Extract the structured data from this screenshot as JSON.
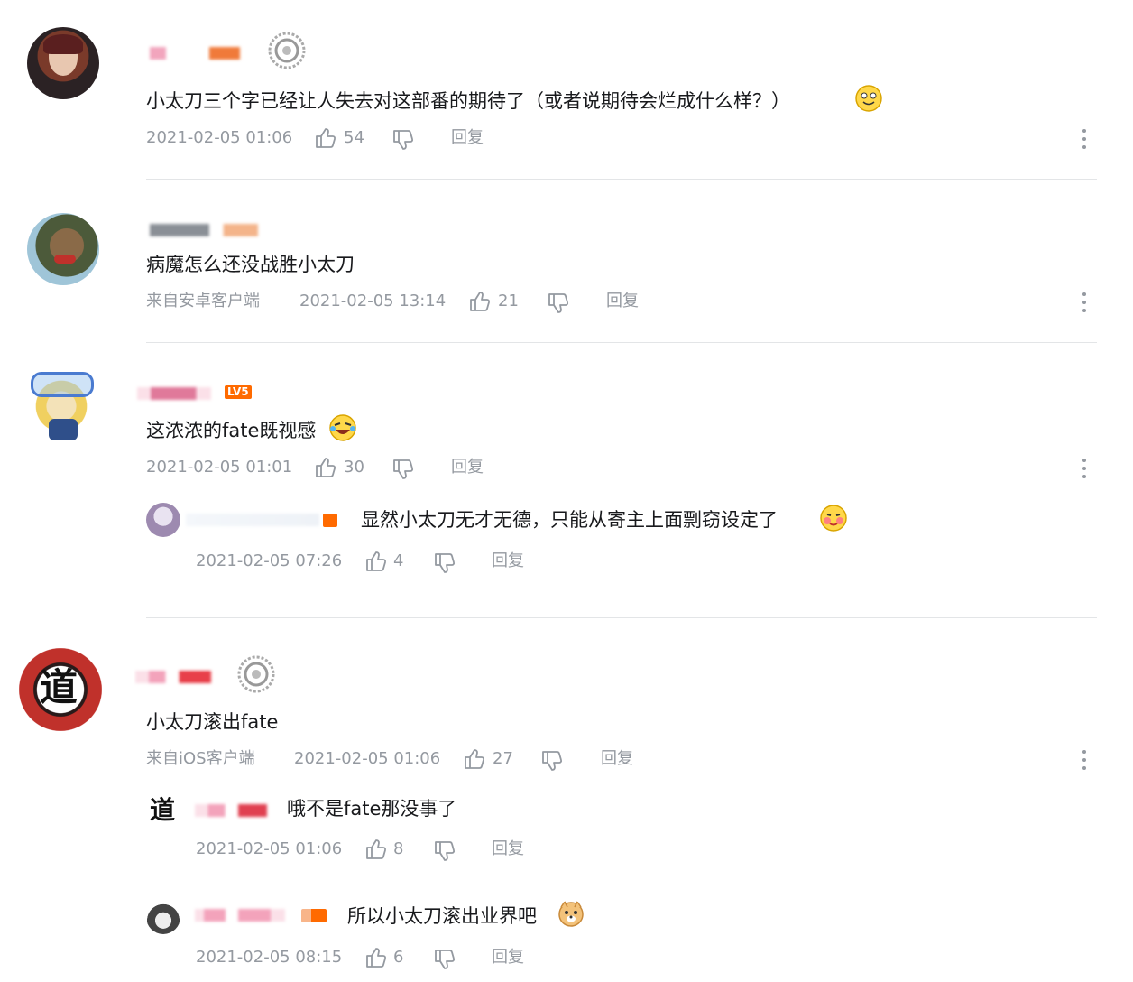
{
  "comments": [
    {
      "text": "小太刀三个字已经让人失去对这部番的期待了（或者说期待会烂成什么样？）",
      "time": "2021-02-05 01:06",
      "likes": "54",
      "reply_label": "回复"
    },
    {
      "text": "病魔怎么还没战胜小太刀",
      "source": "来自安卓客户端",
      "time": "2021-02-05 13:14",
      "likes": "21",
      "reply_label": "回复"
    },
    {
      "text": "这浓浓的fate既视感",
      "time": "2021-02-05 01:01",
      "likes": "30",
      "reply_label": "回复",
      "level": "LV5",
      "replies": [
        {
          "text": "显然小太刀无才无德，只能从寄主上面剽窃设定了",
          "time": "2021-02-05 07:26",
          "likes": "4",
          "reply_label": "回复"
        }
      ]
    },
    {
      "text": "小太刀滚出fate",
      "source": "来自iOS客户端",
      "time": "2021-02-05 01:06",
      "likes": "27",
      "reply_label": "回复",
      "avatar_char": "道",
      "replies": [
        {
          "text": "哦不是fate那没事了",
          "time": "2021-02-05 01:06",
          "likes": "8",
          "reply_label": "回复",
          "avatar_char": "道"
        },
        {
          "text": "所以小太刀滚出业界吧",
          "time": "2021-02-05 08:15",
          "likes": "6",
          "reply_label": "回复"
        }
      ]
    }
  ],
  "colors": {
    "text": "#18191c",
    "meta": "#9499a0",
    "divider": "#e3e5e7",
    "level_orange": "#ff6a00"
  }
}
